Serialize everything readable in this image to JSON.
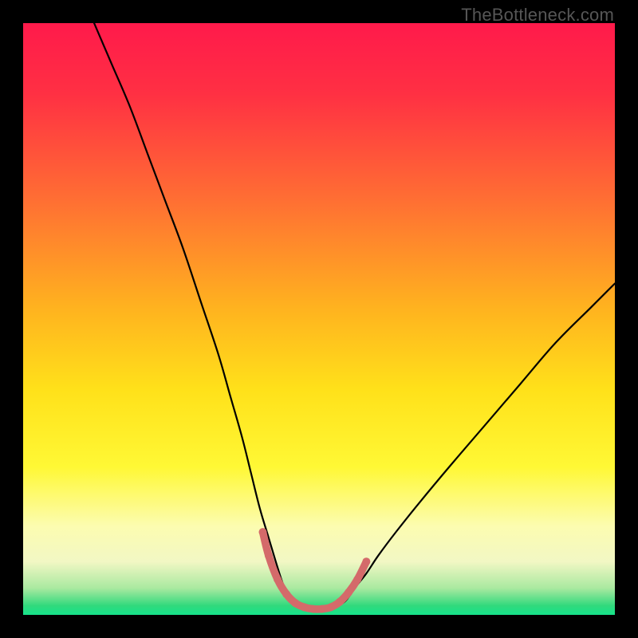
{
  "watermark": "TheBottleneck.com",
  "chart_data": {
    "type": "line",
    "title": "",
    "xlabel": "",
    "ylabel": "",
    "xlim": [
      0,
      100
    ],
    "ylim": [
      0,
      100
    ],
    "grid": false,
    "legend": null,
    "gradient_stops": [
      {
        "offset": 0,
        "color": "#ff1a4b"
      },
      {
        "offset": 0.12,
        "color": "#ff3043"
      },
      {
        "offset": 0.3,
        "color": "#ff6f33"
      },
      {
        "offset": 0.48,
        "color": "#ffb21f"
      },
      {
        "offset": 0.62,
        "color": "#ffe11a"
      },
      {
        "offset": 0.75,
        "color": "#fff835"
      },
      {
        "offset": 0.85,
        "color": "#fcfcb0"
      },
      {
        "offset": 0.91,
        "color": "#f2f7c4"
      },
      {
        "offset": 0.955,
        "color": "#a9e9a0"
      },
      {
        "offset": 0.985,
        "color": "#2fd97c"
      },
      {
        "offset": 1.0,
        "color": "#17e38b"
      }
    ],
    "series": [
      {
        "name": "bottleneck-curve",
        "color": "#000000",
        "x": [
          12,
          15,
          18,
          21,
          24,
          27,
          30,
          33,
          35,
          37,
          38.5,
          40,
          41.5,
          43,
          44,
          45,
          46,
          48,
          50,
          52,
          54,
          55,
          56,
          58,
          60,
          63,
          67,
          72,
          78,
          84,
          90,
          96,
          100
        ],
        "y": [
          100,
          93,
          86,
          78,
          70,
          62,
          53,
          44,
          37,
          30,
          24,
          18,
          13,
          8,
          5,
          3,
          2,
          1.2,
          1,
          1.2,
          2,
          3,
          4.5,
          7,
          10,
          14,
          19,
          25,
          32,
          39,
          46,
          52,
          56
        ]
      }
    ],
    "markers": {
      "name": "trough-markers",
      "color": "#d46a6a",
      "radius_px": 5,
      "points": [
        {
          "x": 40.5,
          "y": 14
        },
        {
          "x": 41.5,
          "y": 10
        },
        {
          "x": 43,
          "y": 6
        },
        {
          "x": 44.5,
          "y": 3.5
        },
        {
          "x": 46,
          "y": 2
        },
        {
          "x": 47.5,
          "y": 1.3
        },
        {
          "x": 49,
          "y": 1
        },
        {
          "x": 50.5,
          "y": 1
        },
        {
          "x": 52,
          "y": 1.3
        },
        {
          "x": 53.5,
          "y": 2.2
        },
        {
          "x": 55,
          "y": 3.8
        },
        {
          "x": 56.5,
          "y": 6
        },
        {
          "x": 58,
          "y": 9
        }
      ]
    }
  }
}
